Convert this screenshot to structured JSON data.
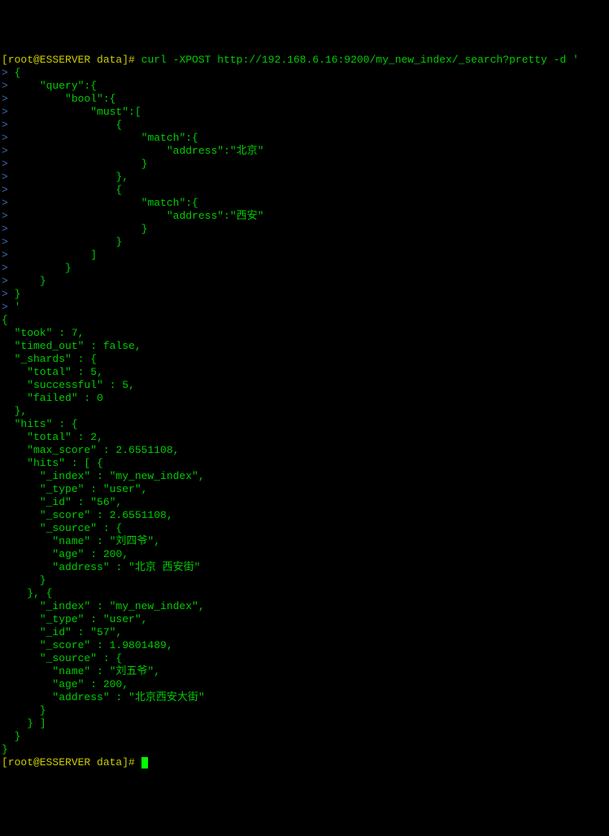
{
  "prompt": {
    "user_host": "[root@ESSERVER data]# ",
    "command": "curl -XPOST http://192.168.6.16:9200/my_new_index/_search?pretty -d '"
  },
  "input_lines": [
    "> {",
    ">     \"query\":{",
    ">         \"bool\":{",
    ">             \"must\":[",
    ">                 {",
    ">                     \"match\":{",
    ">                         \"address\":\"北京\"",
    ">                     }",
    ">                 },",
    ">                 {",
    ">                     \"match\":{",
    ">                         \"address\":\"西安\"",
    ">                     }",
    ">                 }",
    ">             ]",
    ">         }",
    ">     }",
    "> }",
    "> '"
  ],
  "response": [
    "{",
    "  \"took\" : 7,",
    "  \"timed_out\" : false,",
    "  \"_shards\" : {",
    "    \"total\" : 5,",
    "    \"successful\" : 5,",
    "    \"failed\" : 0",
    "  },",
    "  \"hits\" : {",
    "    \"total\" : 2,",
    "    \"max_score\" : 2.6551108,",
    "    \"hits\" : [ {",
    "      \"_index\" : \"my_new_index\",",
    "      \"_type\" : \"user\",",
    "      \"_id\" : \"56\",",
    "      \"_score\" : 2.6551108,",
    "      \"_source\" : {",
    "        \"name\" : \"刘四爷\",",
    "        \"age\" : 200,",
    "        \"address\" : \"北京 西安街\"",
    "      }",
    "    }, {",
    "      \"_index\" : \"my_new_index\",",
    "      \"_type\" : \"user\",",
    "      \"_id\" : \"57\",",
    "      \"_score\" : 1.9801489,",
    "      \"_source\" : {",
    "        \"name\" : \"刘五爷\",",
    "        \"age\" : 200,",
    "        \"address\" : \"北京西安大街\"",
    "      }",
    "    } ]",
    "  }",
    "}"
  ],
  "final_prompt": "[root@ESSERVER data]# "
}
